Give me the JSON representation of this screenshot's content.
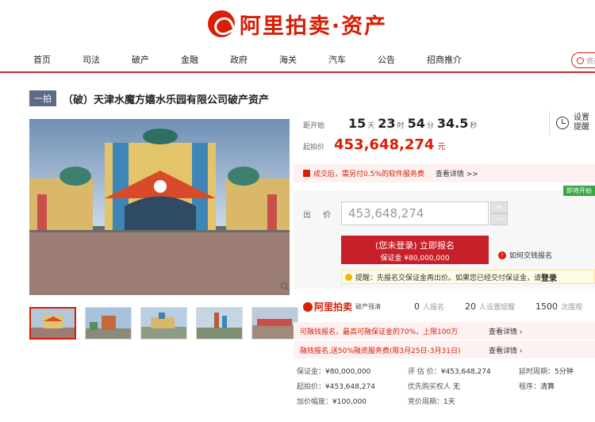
{
  "brand": {
    "name": "阿里拍卖·资产"
  },
  "nav": {
    "items": [
      "首页",
      "司法",
      "破产",
      "金融",
      "政府",
      "海关",
      "汽车",
      "公告",
      "招商推介"
    ],
    "search_placeholder": "资产"
  },
  "lot": {
    "tag": "一拍",
    "title": "（破）天津水魔方嬉水乐园有限公司破产资产"
  },
  "countdown": {
    "label": "距开始",
    "days": "15",
    "days_unit": "天",
    "hours": "23",
    "hours_unit": "时",
    "minutes": "54",
    "minutes_unit": "分",
    "seconds": "34.5",
    "seconds_unit": "秒"
  },
  "start_price": {
    "label": "起拍价",
    "value": "453,648,274",
    "unit": "元"
  },
  "reminder": {
    "label": "设置提醒"
  },
  "fee": {
    "text": "成交后，需另付0.5%的软件服务费",
    "link": "查看详情 >>"
  },
  "bid": {
    "badge": "即将开始",
    "label": "出 价",
    "value": "453,648,274",
    "plus": "+",
    "minus": "−",
    "signup_line1": "(您未登录) 立即报名",
    "signup_line2": "保证金 ¥80,000,000",
    "how_to_pay": "如何交钱报名"
  },
  "tip": {
    "prefix": "提醒：先报名交保证金再出价。如果您已经交付保证金，请",
    "login": "登录"
  },
  "stats": {
    "logo_name": "阿里拍卖",
    "logo_sub": "破产强清",
    "signups": "0",
    "signups_label": "人报名",
    "reminders": "20",
    "reminders_label": "人设置提醒",
    "views": "1500",
    "views_label": "次围观"
  },
  "promos": [
    {
      "text": "可融钱报名，最高可融保证金的70%，上限100万",
      "link": "查看详情 ›"
    },
    {
      "text": "融钱报名,送50%融资服务费(限3月25日-3月31日)",
      "link": "查看详情 ›"
    }
  ],
  "details": {
    "deposit_label": "保证金：",
    "deposit": "¥80,000,000",
    "appraisal_label": "评 估 价：",
    "appraisal": "¥453,648,274",
    "delay_label": "延时周期：",
    "delay": "5分钟",
    "start_label": "起拍价：",
    "start": "¥453,648,274",
    "priority_label": "优先购买权人",
    "priority": "无",
    "procedure_label": "程序：",
    "procedure": "清算",
    "increment_label": "加价幅度：",
    "increment": "¥100,000",
    "period_label": "竞价周期：",
    "period": "1天"
  }
}
